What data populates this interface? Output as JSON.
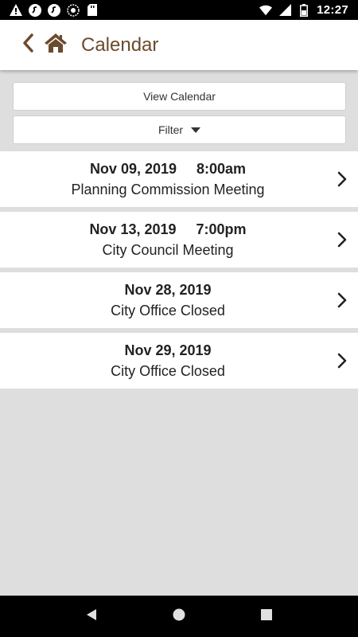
{
  "status_bar": {
    "time": "12:27",
    "left_icons": [
      "warning-icon",
      "app-icon",
      "app-icon",
      "sync-icon",
      "sd-card-icon"
    ],
    "right_icons": [
      "wifi-icon",
      "signal-icon",
      "battery-icon"
    ]
  },
  "app_bar": {
    "title": "Calendar",
    "accent_color": "#6b4b2c"
  },
  "controls": {
    "view_calendar_label": "View Calendar",
    "filter_label": "Filter"
  },
  "events": [
    {
      "when": "Nov 09, 2019     8:00am",
      "title": "Planning Commission Meeting"
    },
    {
      "when": "Nov 13, 2019     7:00pm",
      "title": "City Council Meeting"
    },
    {
      "when": "Nov 28, 2019",
      "title": "City Office Closed"
    },
    {
      "when": "Nov 29, 2019",
      "title": "City Office Closed"
    }
  ],
  "nav_bar": {
    "icons": [
      "back-triangle-icon",
      "home-circle-icon",
      "recents-square-icon"
    ]
  }
}
